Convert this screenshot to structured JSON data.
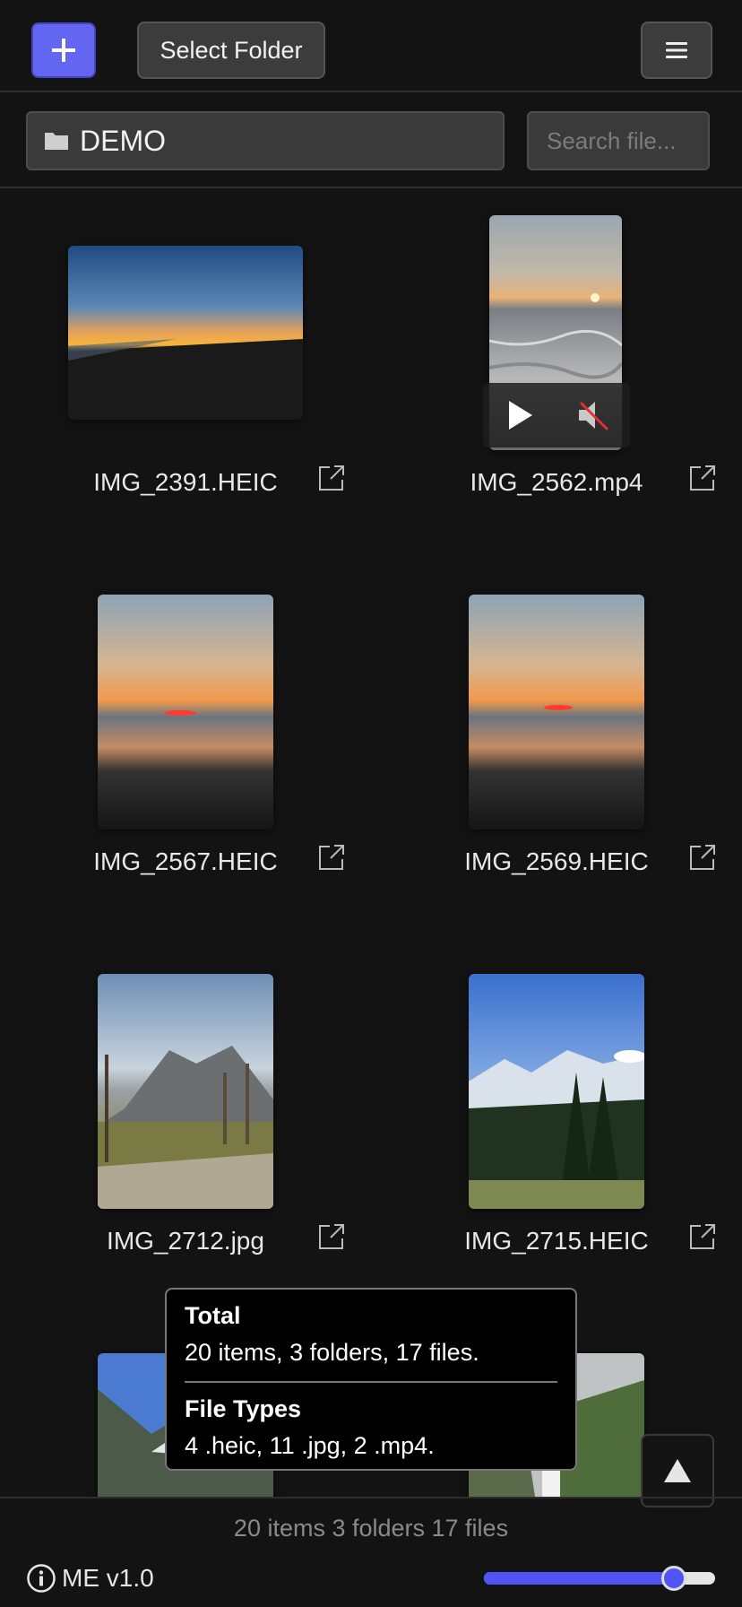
{
  "toolbar": {
    "add_label": "+",
    "select_folder_label": "Select Folder",
    "menu_icon": "hamburger-menu-icon"
  },
  "pathbar": {
    "folder_icon": "folder-icon",
    "current_path": "DEMO",
    "search_placeholder": "Search file..."
  },
  "files": [
    {
      "name": "IMG_2391.HEIC",
      "type": "heic"
    },
    {
      "name": "IMG_2562.mp4",
      "type": "mp4"
    },
    {
      "name": "IMG_2567.HEIC",
      "type": "heic"
    },
    {
      "name": "IMG_2569.HEIC",
      "type": "heic"
    },
    {
      "name": "IMG_2712.jpg",
      "type": "jpg"
    },
    {
      "name": "IMG_2715.HEIC",
      "type": "heic"
    }
  ],
  "tooltip": {
    "total_title": "Total",
    "total_items": "20 items",
    "total_folders": "3 folders",
    "total_files": "17 files",
    "types_title": "File Types",
    "type_heic": "4 .heic",
    "type_jpg": "11 .jpg",
    "type_mp4": "2 .mp4"
  },
  "status_text": "20 items 3 folders 17 files",
  "footer": {
    "version": "ME v1.0",
    "zoom_level": 0.86
  },
  "colors": {
    "accent": "#6366f1",
    "background": "#131313"
  }
}
